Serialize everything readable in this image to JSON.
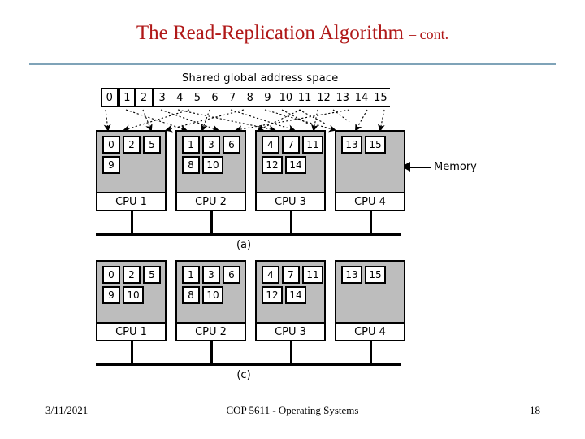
{
  "slide": {
    "title_main": "The Read-Replication Algorithm",
    "title_sub": "– cont.",
    "rule_color": "#7fa3b8",
    "title_color": "#b01818"
  },
  "figure": {
    "address_space": {
      "caption": "Shared global address space",
      "cells": [
        "0",
        "1",
        "2",
        "3",
        "4",
        "5",
        "6",
        "7",
        "8",
        "9",
        "10",
        "11",
        "12",
        "13",
        "14",
        "15"
      ]
    },
    "memory_callout": {
      "label": "Memory",
      "arrow_icon": "left-arrow-icon"
    },
    "panels": [
      {
        "id": "panel-a",
        "caption": "(a)",
        "cpus": [
          {
            "label": "CPU 1",
            "row1": [
              "0",
              "2",
              "5"
            ],
            "row2": [
              "9"
            ]
          },
          {
            "label": "CPU 2",
            "row1": [
              "1",
              "3",
              "6"
            ],
            "row2": [
              "8",
              "10"
            ]
          },
          {
            "label": "CPU 3",
            "row1": [
              "4",
              "7",
              "11"
            ],
            "row2": [
              "12",
              "14"
            ]
          },
          {
            "label": "CPU 4",
            "row1": [
              "13",
              "15"
            ],
            "row2": []
          }
        ]
      },
      {
        "id": "panel-c",
        "caption": "(c)",
        "cpus": [
          {
            "label": "CPU 1",
            "row1": [
              "0",
              "2",
              "5"
            ],
            "row2": [
              "9",
              "10"
            ]
          },
          {
            "label": "CPU 2",
            "row1": [
              "1",
              "3",
              "6"
            ],
            "row2": [
              "8",
              "10"
            ]
          },
          {
            "label": "CPU 3",
            "row1": [
              "4",
              "7",
              "11"
            ],
            "row2": [
              "12",
              "14"
            ]
          },
          {
            "label": "CPU 4",
            "row1": [
              "13",
              "15"
            ],
            "row2": []
          }
        ]
      }
    ],
    "colors": {
      "memory_fill": "#bdbdbd",
      "cell_fill": "#ffffff",
      "outline": "#000000"
    }
  },
  "footer": {
    "date": "3/11/2021",
    "center": "COP 5611 - Operating Systems",
    "page": "18"
  }
}
